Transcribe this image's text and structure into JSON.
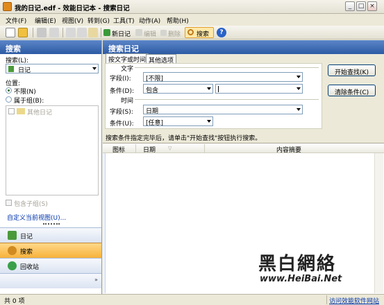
{
  "window": {
    "title": "我的日记.edf - 效能日记本 - 搜索日记",
    "buttons": [
      "_",
      "□",
      "×"
    ]
  },
  "menu": [
    "文件(F)",
    "编辑(E)",
    "视图(V)",
    "转到(G)",
    "工具(T)",
    "动作(A)",
    "帮助(H)"
  ],
  "toolbar": {
    "new_diary": "新日记",
    "edit": "编辑",
    "delete": "删除",
    "search": "搜索"
  },
  "left": {
    "header": "搜索",
    "search_label": "搜索(L):",
    "search_value": "日记",
    "position_label": "位置:",
    "option_all": "不限(N)",
    "option_group": "属于组(B):",
    "tree_item": "其他日记",
    "include_sub": "包含子组(S)",
    "custom_view_link": "自定义当前视图(U)...",
    "nav": [
      "日记",
      "搜索",
      "回收站"
    ]
  },
  "right": {
    "header": "搜索日记",
    "tabs": [
      "按文字或时间",
      "其他选项"
    ],
    "text_group": "文字",
    "field_label": "字段(I):",
    "field_value": "[不限]",
    "cond_label": "条件(D):",
    "cond_value": "包含",
    "time_group": "时间",
    "time_field_label": "字段(S):",
    "time_field_value": "日期",
    "time_cond_label": "条件(U):",
    "time_cond_value": "[任意]",
    "start_button": "开始查找(K)",
    "clear_button": "清除条件(C)",
    "hint": "搜索条件指定完毕后，请单击\"开始查找\"按钮执行搜索。",
    "columns": [
      "图标",
      "日期",
      "内容摘要"
    ]
  },
  "watermark": {
    "title": "黑白網絡",
    "url": "www.HeiBai.Net"
  },
  "status": {
    "left": "共 0 项",
    "right": "访问效能软件网站"
  }
}
